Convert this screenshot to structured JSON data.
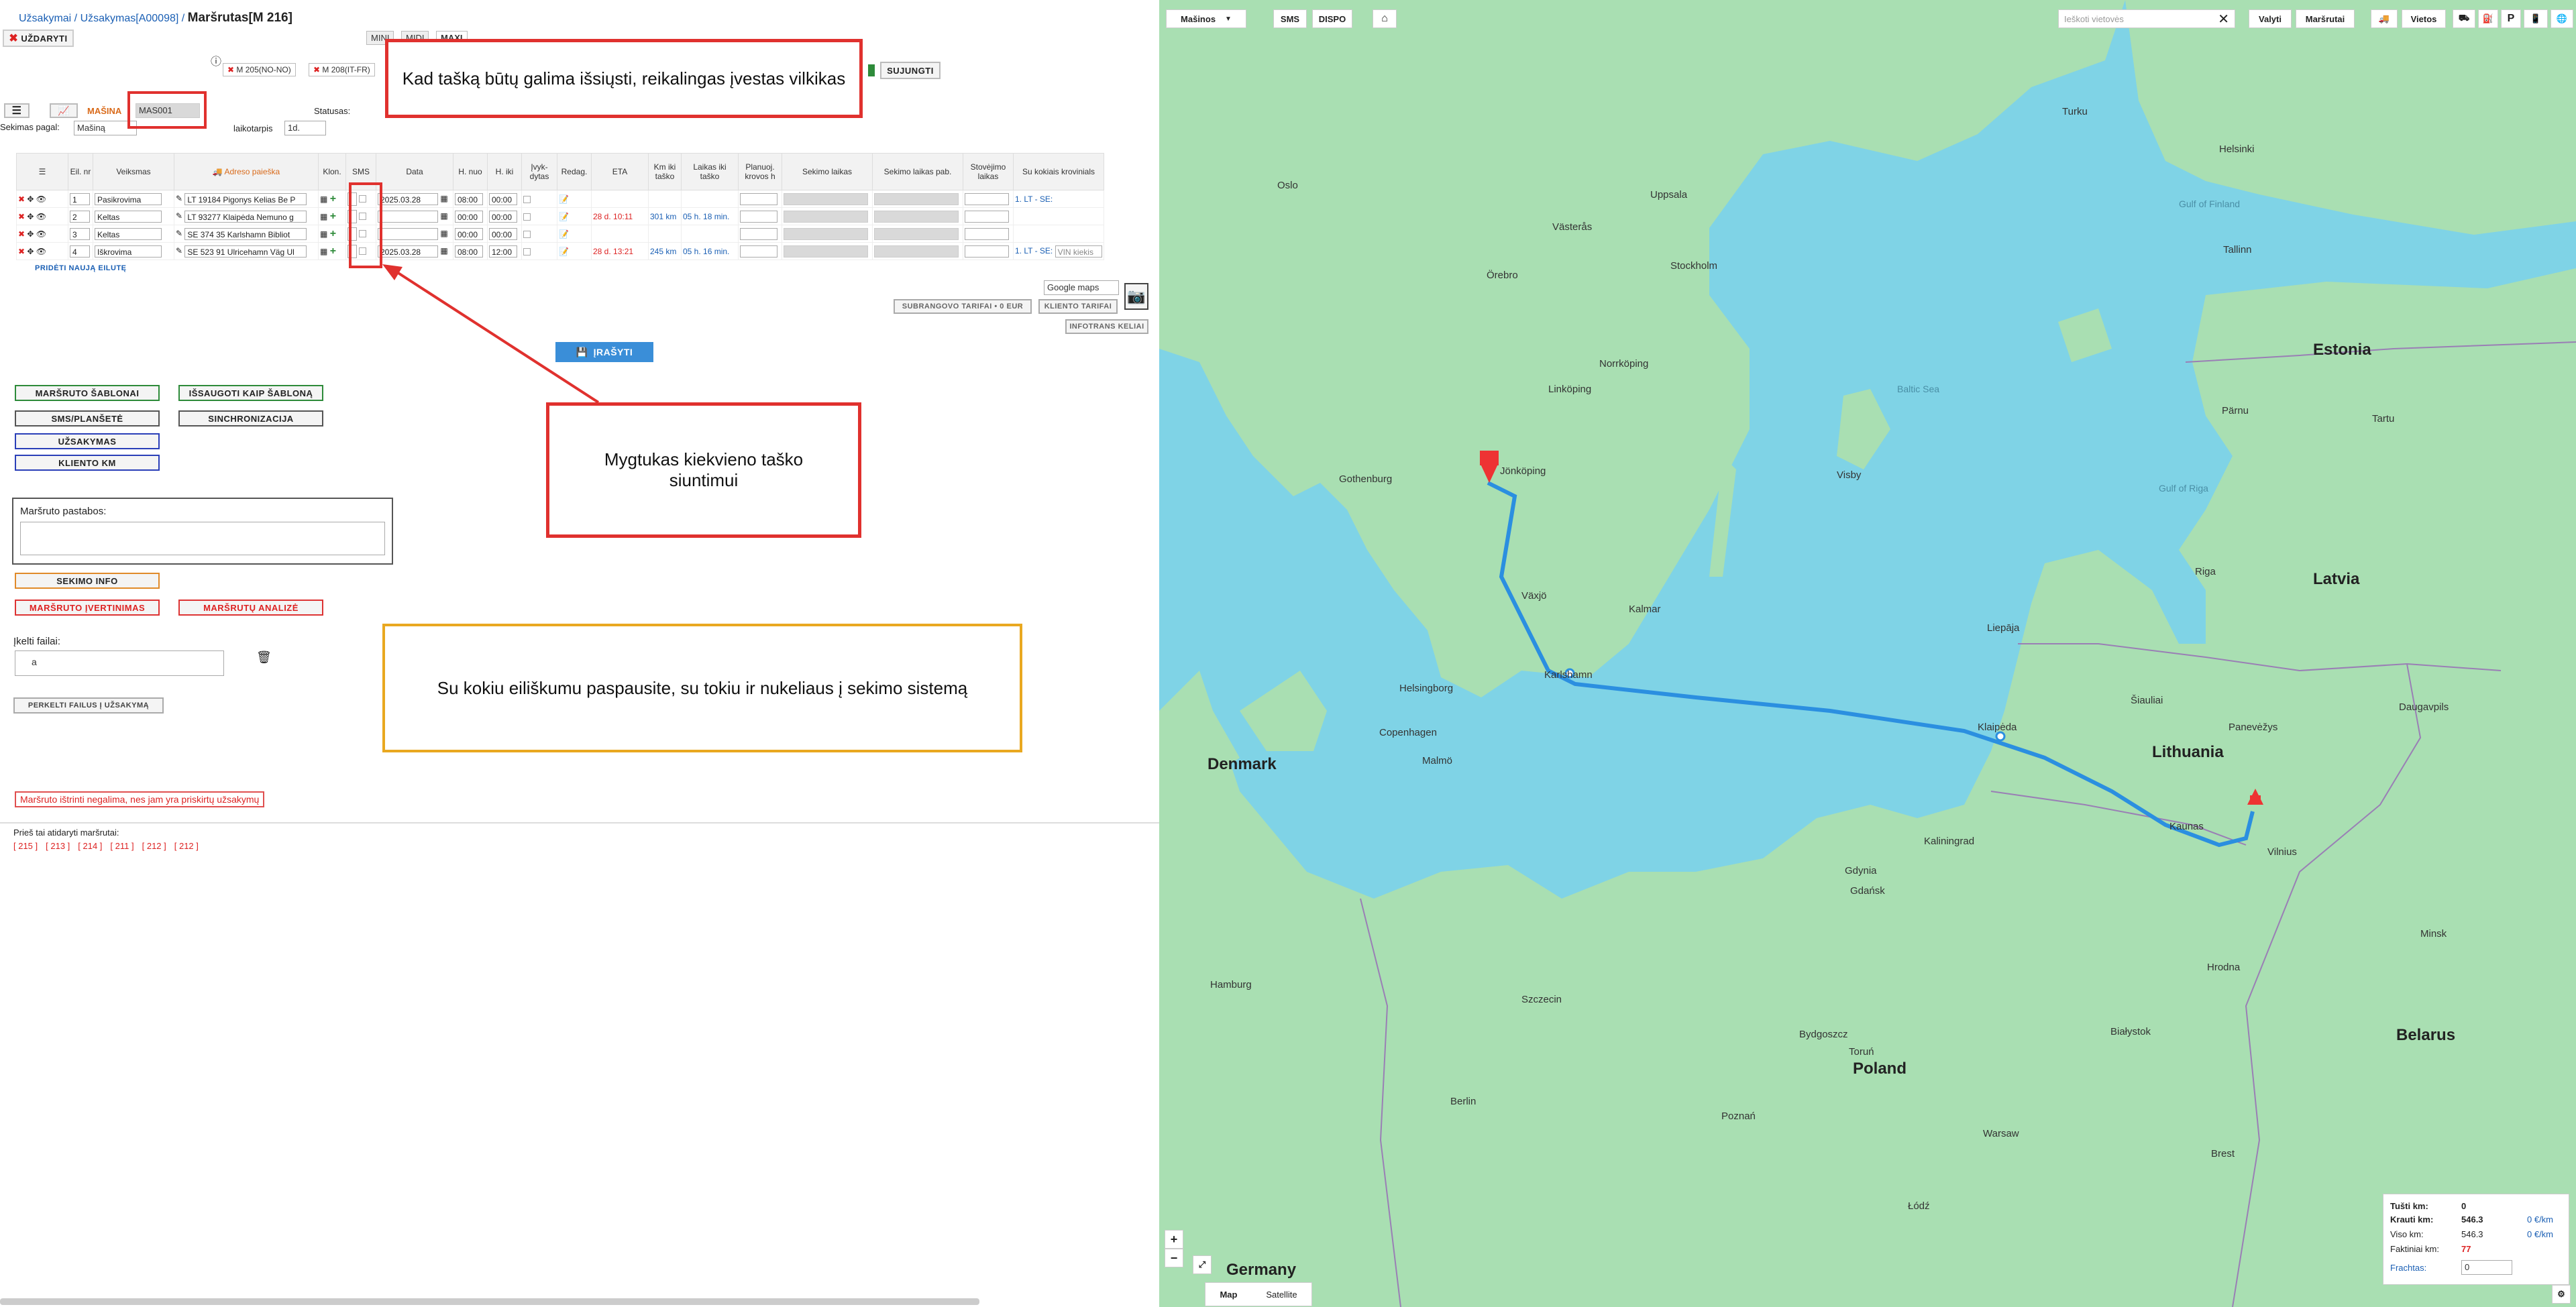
{
  "breadcrumb": {
    "item1": "Užsakymai",
    "sep": " / ",
    "item2": "Užsakymas[A00098]",
    "title": "Maršrutas[M 216]"
  },
  "top": {
    "close_label": "UŽDARYTI",
    "mini": "MINI",
    "midi": "MIDI",
    "maxi": "MAXI",
    "route_chip1": "M 205(NO-NO)",
    "route_chip2": "M 208(IT-FR)",
    "connect_label": "SUJUNGTI",
    "info_mark": "ⓘ"
  },
  "toolbar": {
    "vehicle_label": "MAŠINA",
    "vehicle_value": "MAS001",
    "status_label": "Statusas:",
    "sort_label": "Sekimas pagal:",
    "sort_value": "Mašiną",
    "interval_label": "laikotarpis",
    "interval_value": "1d."
  },
  "table": {
    "headers": [
      "Eil. nr",
      "Veiksmas",
      "Adreso paieška",
      "Klon.",
      "SMS",
      "Data",
      "H. nuo",
      "H. iki",
      "Įvyk-dytas",
      "Redag.",
      "ETA",
      "Km iki taško",
      "Laikas iki taško",
      "Planuoj. krovos h",
      "Sekimo laikas",
      "Sekimo laikas pab.",
      "Stovėjimo laikas",
      "Su kokiais krovinials"
    ],
    "rows": [
      {
        "nr": "1",
        "action": "Pasikrovima",
        "address": "LT 19184 Pigonys Kelias Be P",
        "date": "2025.03.28",
        "from": "08:00",
        "to": "00:00",
        "eta": "",
        "km": "",
        "time": "",
        "cargo": "1. LT - SE:"
      },
      {
        "nr": "2",
        "action": "Keltas",
        "address": "LT 93277 Klaipėda Nemuno g",
        "date": "",
        "from": "00:00",
        "to": "00:00",
        "eta": "28 d. 10:11",
        "km": "301 km",
        "time": "05 h. 18 min.",
        "cargo": ""
      },
      {
        "nr": "3",
        "action": "Keltas",
        "address": "SE 374 35 Karlshamn Bibliot",
        "date": "",
        "from": "00:00",
        "to": "00:00",
        "eta": "",
        "km": "",
        "time": "",
        "cargo": ""
      },
      {
        "nr": "4",
        "action": "Iškrovima",
        "address": "SE 523 91 Ulricehamn Väg Ul",
        "date": "2025.03.28",
        "from": "08:00",
        "to": "12:00",
        "eta": "28 d. 13:21",
        "km": "245 km",
        "time": "05 h. 16 min.",
        "cargo": "1. LT - SE:",
        "cargo_extra": "VIN kiekis"
      }
    ],
    "add_row": "PRIDĖTI NAUJĄ EILUTĘ"
  },
  "side": {
    "maps_select": "Google maps",
    "subcontract": "SUBRANGOVO TARIFAI • 0 EUR",
    "client_tariff": "KLIENTO TARIFAI",
    "infotrans": "INFOTRANS KELIAI",
    "save": "ĮRAŠYTI"
  },
  "actions": {
    "templates": "MARŠRUTO ŠABLONAI",
    "save_template": "IŠSAUGOTI KAIP ŠABLONĄ",
    "sms": "SMS/PLANŠETĖ",
    "sync": "SINCHRONIZACIJA",
    "order": "UŽSAKYMAS",
    "client_km": "KLIENTO KM",
    "notes_label": "Maršruto pastabos:",
    "tracking_info": "SEKIMO INFO",
    "route_rating": "MARŠRUTO ĮVERTINIMAS",
    "route_analysis": "MARŠRUTŲ ANALIZĖ",
    "files_label": "Įkelti failai:",
    "file_value": "a",
    "move_files": "PERKELTI FAILUS Į UŽSAKYMĄ",
    "cannot_delete": "Maršruto ištrinti negalima, nes jam yra priskirtų užsakymų",
    "prev_label": "Prieš tai atidaryti maršrutai:",
    "prev_routes": [
      "[ 215 ]",
      "[ 213 ]",
      "[ 214 ]",
      "[ 211 ]",
      "[ 212 ]",
      "[ 212 ]"
    ]
  },
  "callouts": {
    "c1": "Kad tašką būtų galima išsiųsti, reikalingas įvestas vilkikas",
    "c2": "Mygtukas kiekvieno taško siuntimui",
    "c3": "Su kokiu eiliškumu paspausite, su tokiu ir nukeliaus į sekimo sistemą"
  },
  "map": {
    "toolbar": {
      "vehicles": "Mašinos",
      "sms": "SMS",
      "dispo": "DISPO",
      "search_placeholder": "Ieškoti vietovės",
      "valyti": "Valyti",
      "routes": "Maršrutai",
      "places": "Vietos"
    },
    "map_label": "Map",
    "satellite_label": "Satellite",
    "stats": {
      "empty_label": "Tušti km:",
      "empty_value": "0",
      "loaded_label": "Krauti km:",
      "loaded_value": "546.3",
      "loaded_rate": "0 €/km",
      "total_label": "Viso km:",
      "total_value": "546.3",
      "total_rate": "0 €/km",
      "actual_label": "Faktiniai km:",
      "actual_value": "77",
      "freight_label": "Frachtas:",
      "freight_value": "0"
    },
    "countries": [
      "Estonia",
      "Latvia",
      "Lithuania",
      "Denmark",
      "Poland",
      "Germany",
      "Belarus"
    ],
    "cities": [
      "Oslo",
      "Turku",
      "Helsinki",
      "Tallinn",
      "Stockholm",
      "Uppsala",
      "Västerås",
      "Örebro",
      "Linköping",
      "Norrköping",
      "Jönköping",
      "Gothenburg",
      "Växjö",
      "Karlshamn",
      "Kalmar",
      "Malmö",
      "Copenhagen",
      "Helsingborg",
      "Riga",
      "Liepāja",
      "Klaipėda",
      "Šiauliai",
      "Panevėžys",
      "Kaunas",
      "Vilnius",
      "Daugavpils",
      "Kaliningrad",
      "Gdańsk",
      "Gdynia",
      "Szczecin",
      "Bydgoszcz",
      "Toruń",
      "Hamburg",
      "Berlin",
      "Poznań",
      "Białystok",
      "Hrodna",
      "Minsk",
      "Warsaw",
      "Łódź",
      "Brest",
      "Visby",
      "Tartu",
      "Pärnu"
    ],
    "seas": [
      "Baltic Sea",
      "Gulf of Finland",
      "Gulf of Riga"
    ]
  },
  "colors": {
    "route": "#2b8fe0",
    "water": "#7fd3e6",
    "land": "#a9dfb2",
    "callout_red": "#e0312e",
    "callout_orange": "#e9a820"
  }
}
